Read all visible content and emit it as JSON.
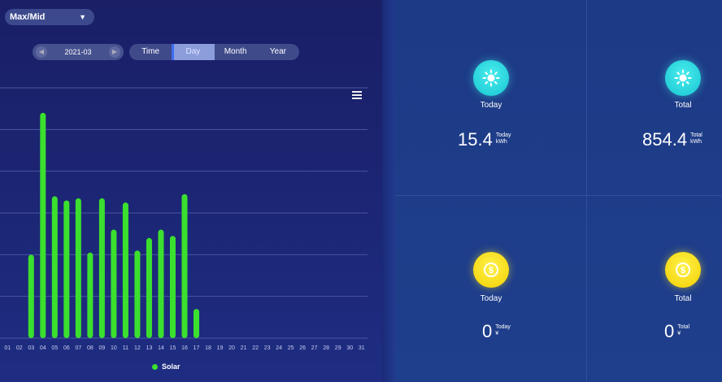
{
  "selector": {
    "value": "Max/Mid"
  },
  "date_picker": {
    "value": "2021-03"
  },
  "modes": [
    "Time",
    "Day",
    "Month",
    "Year"
  ],
  "active_mode": "Day",
  "legend": {
    "label": "Solar"
  },
  "colors": {
    "series": "#3be02e",
    "grid": "#4a55a0",
    "sun": "#22d1dc",
    "coin": "#f7d90a"
  },
  "stats": {
    "energy_today": {
      "label": "Today",
      "value": "15.4",
      "meta_top": "Today",
      "meta_bottom": "kWh",
      "icon": "sun-icon"
    },
    "energy_total": {
      "label": "Total",
      "value": "854.4",
      "meta_top": "Total",
      "meta_bottom": "kWh",
      "icon": "sun-icon"
    },
    "income_today": {
      "label": "Today",
      "value": "0",
      "meta_top": "Today",
      "meta_bottom": "¥",
      "icon": "coin-icon"
    },
    "income_total": {
      "label": "Total",
      "value": "0",
      "meta_top": "Total",
      "meta_bottom": "¥",
      "icon": "coin-icon"
    }
  },
  "chart_data": {
    "type": "bar",
    "categories": [
      "01",
      "02",
      "03",
      "04",
      "05",
      "06",
      "07",
      "08",
      "09",
      "10",
      "11",
      "12",
      "13",
      "14",
      "15",
      "16",
      "17",
      "18",
      "19",
      "20",
      "21",
      "22",
      "23",
      "24",
      "25",
      "26",
      "27",
      "28",
      "29",
      "30",
      "31"
    ],
    "series": [
      {
        "name": "Solar",
        "values": [
          null,
          null,
          20,
          54,
          34,
          33,
          33.5,
          20.5,
          33.5,
          26,
          32.5,
          21,
          24,
          26,
          24.5,
          34.5,
          7,
          null,
          null,
          null,
          null,
          null,
          null,
          null,
          null,
          null,
          null,
          null,
          null,
          null,
          null
        ]
      }
    ],
    "ylim": [
      0,
      60
    ],
    "grid": true,
    "legend_position": "bottom"
  }
}
